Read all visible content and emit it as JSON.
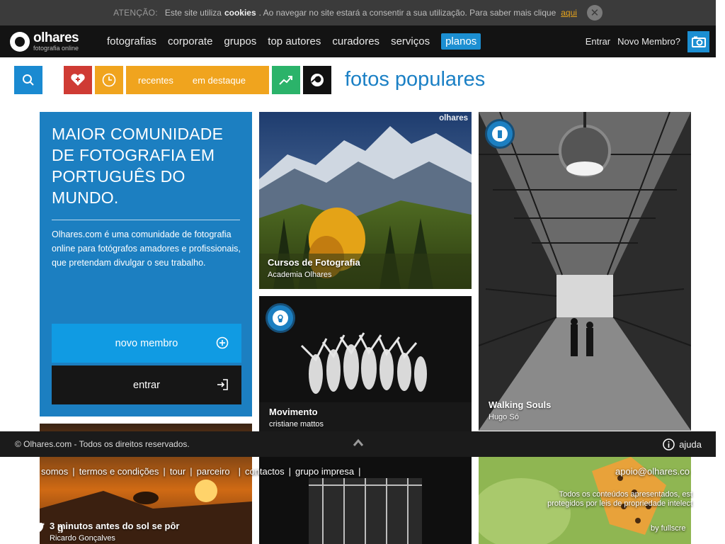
{
  "cookie": {
    "warning": "ATENÇÃO:",
    "text_before": "Este site utiliza",
    "bold_word": "cookies",
    "text_after": ". Ao navegar no site estará a consentir a sua utilização. Para saber mais clique",
    "link": "aqui"
  },
  "brand": {
    "name": "olhares",
    "tagline": "fotografia online"
  },
  "nav": {
    "items": [
      "fotografias",
      "corporate",
      "grupos",
      "top autores",
      "curadores",
      "serviços"
    ],
    "highlight": "planos",
    "login": "Entrar",
    "signup": "Novo Membro?"
  },
  "toolbar": {
    "tab_recent": "recentes",
    "tab_featured": "em destaque"
  },
  "page_title": "fotos populares",
  "promo": {
    "heading": "MAIOR COMUNIDADE DE FOTOGRAFIA EM PORTUGUÊS DO MUNDO.",
    "body": "Olhares.com é uma comunidade de fotografia online para fotógrafos amadores e profissionais, que pretendam divulgar o seu trabalho.",
    "new_member": "novo membro",
    "enter": "entrar"
  },
  "photos": [
    {
      "title": "Cursos de Fotografia",
      "author": "Academia Olhares",
      "watermark": "olhares"
    },
    {
      "title": "Walking Souls",
      "author": "Hugo Só"
    },
    {
      "title": "Movimento",
      "author": "cristiane mattos"
    },
    {
      "title": "3 minutos antes do sol se pôr",
      "author": "Ricardo Gonçalves"
    }
  ],
  "footer": {
    "copyright": "© Olhares.com - Todos os direitos reservados.",
    "help": "ajuda",
    "links": [
      "somos",
      "termos e condições",
      "tour",
      "parceiro",
      "contactos",
      "grupo impresa"
    ],
    "email": "apoio@olhares.co",
    "note": "Todos os conteúdos apresentados, est protegidos por leis de propriedade intelect",
    "by": "by fullscre"
  },
  "colors": {
    "accent": "#1c8fd2",
    "promo_blue": "#1c7fc1",
    "orange": "#f0a41e",
    "red": "#cf3b34",
    "green": "#2bb36a"
  }
}
